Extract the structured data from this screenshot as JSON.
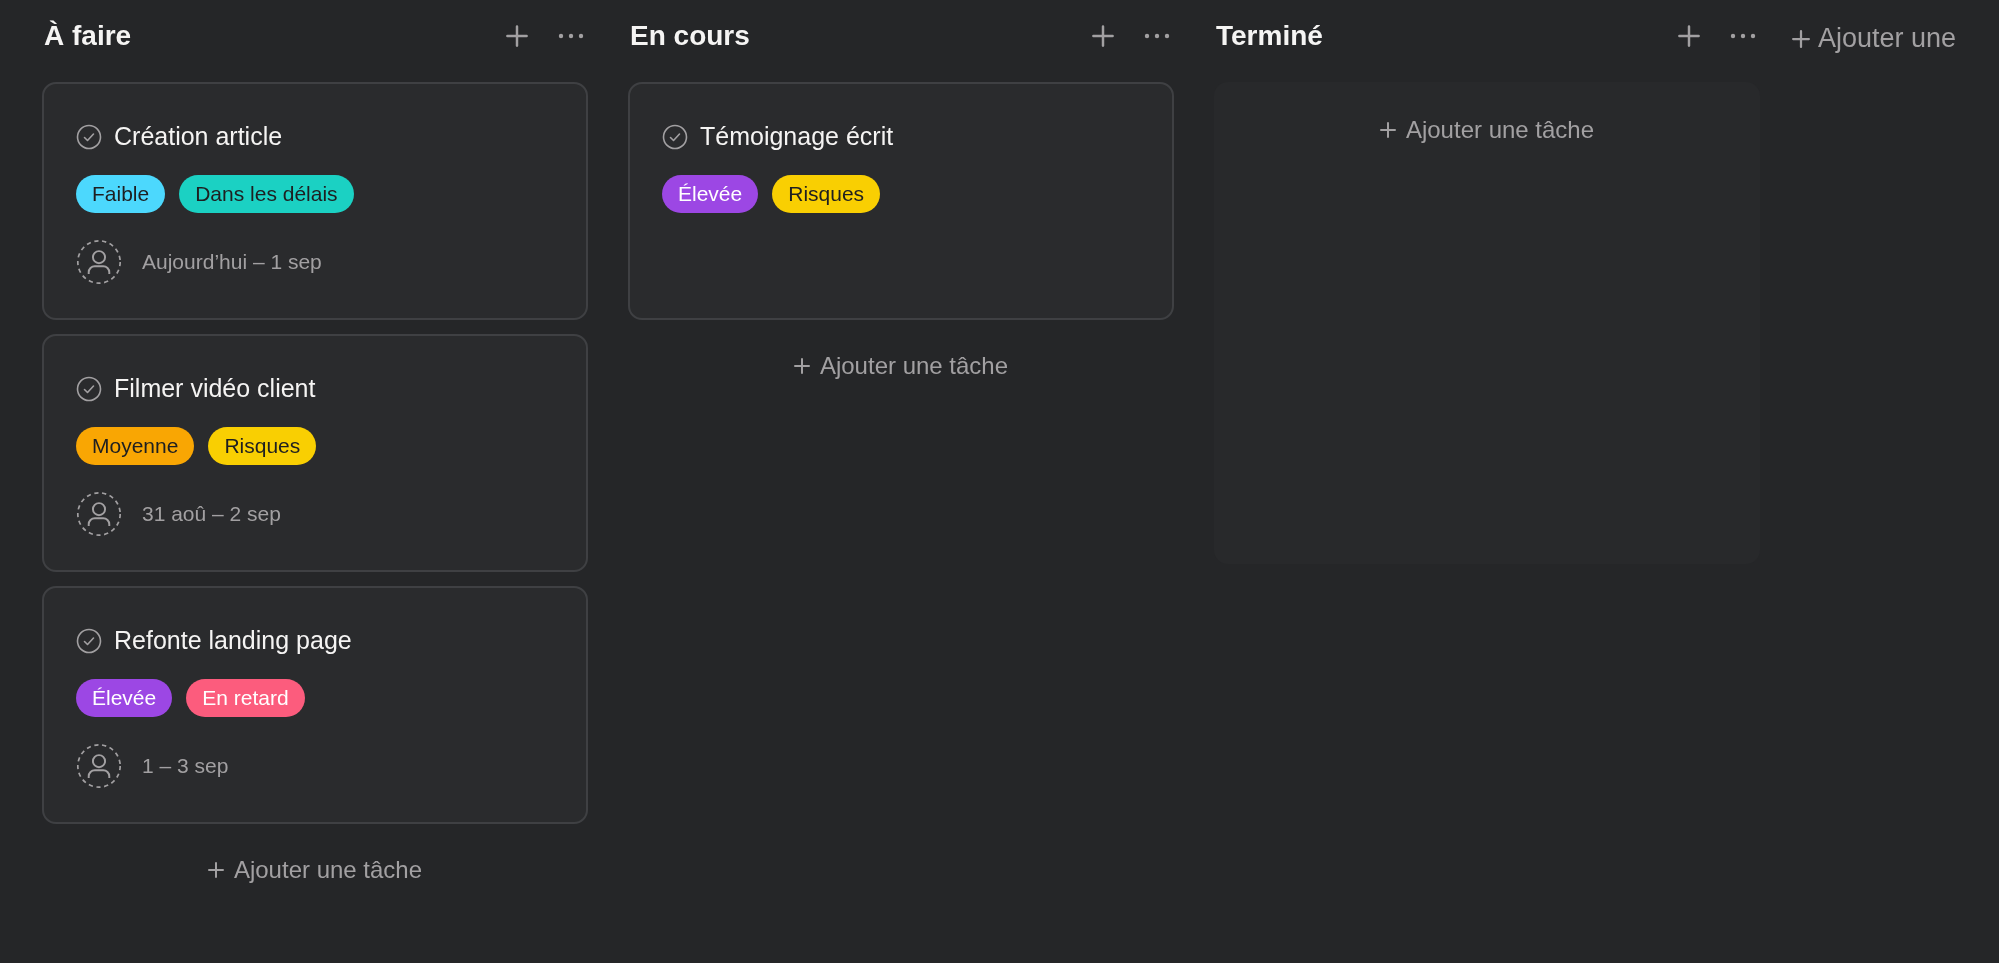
{
  "columns": [
    {
      "title": "À faire",
      "add_task_label": "Ajouter une tâche",
      "tasks": [
        {
          "title": "Création article",
          "completed": false,
          "tags": [
            {
              "label": "Faible",
              "color": "#4cd8fd"
            },
            {
              "label": "Dans les délais",
              "color": "#1bd1c3"
            }
          ],
          "date": "Aujourd’hui – 1 sep"
        },
        {
          "title": "Filmer vidéo client",
          "completed": false,
          "tags": [
            {
              "label": "Moyenne",
              "color": "#f9a603"
            },
            {
              "label": "Risques",
              "color": "#f9cf02"
            }
          ],
          "date": "31 aoû – 2 sep"
        },
        {
          "title": "Refonte landing page",
          "completed": false,
          "tags": [
            {
              "label": "Élevée",
              "color": "#9c47e4"
            },
            {
              "label": "En retard",
              "color": "#fc5c7d"
            }
          ],
          "date": "1 – 3 sep"
        }
      ]
    },
    {
      "title": "En cours",
      "add_task_label": "Ajouter une tâche",
      "tasks": [
        {
          "title": "Témoignage écrit",
          "completed": false,
          "tags": [
            {
              "label": "Élevée",
              "color": "#9c47e4"
            },
            {
              "label": "Risques",
              "color": "#f9cf02"
            }
          ]
        }
      ]
    },
    {
      "title": "Terminé",
      "add_task_label": "Ajouter une tâche"
    }
  ],
  "add_column_label": "Ajouter une"
}
